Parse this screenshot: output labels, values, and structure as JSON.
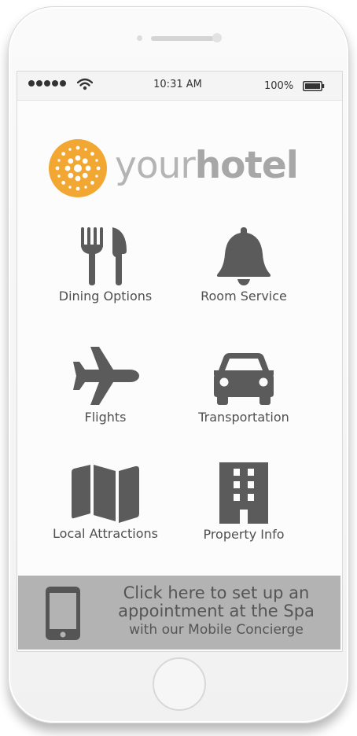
{
  "status": {
    "time": "10:31 AM",
    "battery": "100%"
  },
  "brand": {
    "name_light": "your",
    "name_bold": "hotel",
    "accent": "#f3a733"
  },
  "menu": [
    {
      "label": "Dining Options",
      "icon": "fork-knife-icon"
    },
    {
      "label": "Room Service",
      "icon": "bell-icon"
    },
    {
      "label": "Flights",
      "icon": "airplane-icon"
    },
    {
      "label": "Transportation",
      "icon": "car-icon"
    },
    {
      "label": "Local Attractions",
      "icon": "map-icon"
    },
    {
      "label": "Property Info",
      "icon": "building-icon"
    }
  ],
  "banner": {
    "line1": "Click here to set up an",
    "line2": "appointment at the Spa",
    "line3": "with our Mobile Concierge",
    "icon": "mobile-phone-icon"
  },
  "colors": {
    "icon": "#5b5b5b",
    "banner_bg": "#b3b3b3",
    "banner_text": "#555555"
  }
}
